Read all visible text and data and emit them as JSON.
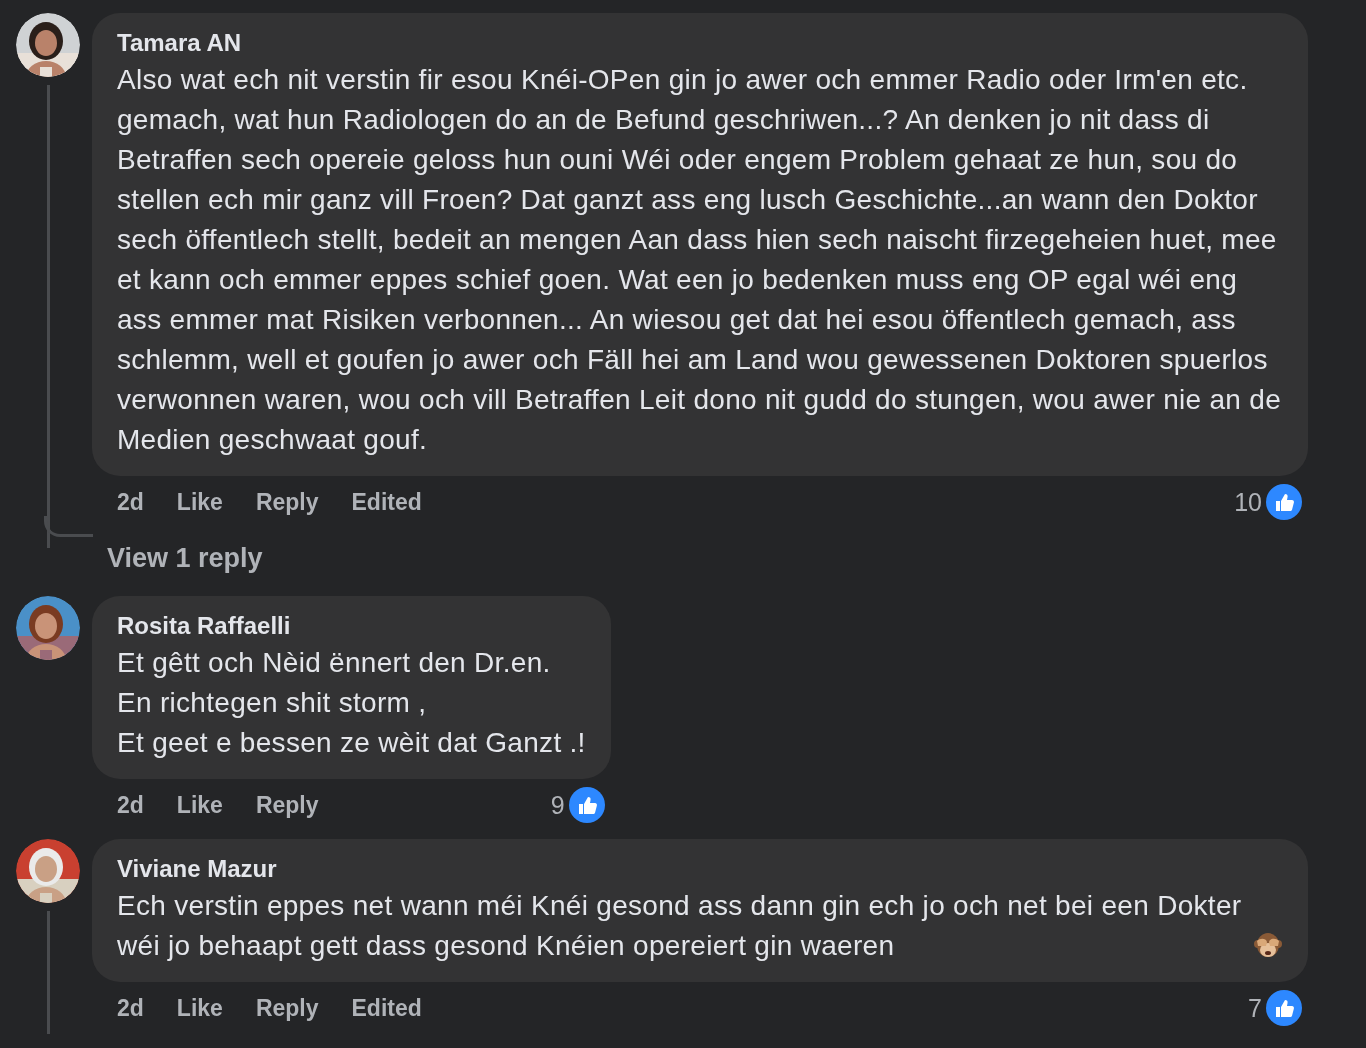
{
  "comments": [
    {
      "author": "Tamara AN",
      "text": "Also wat ech nit verstin fir esou Knéi-OPen gin jo awer och emmer Radio oder Irm'en etc. gemach, wat hun Radiologen do an de Befund geschriwen...? An denken jo nit dass di Betraffen sech opereie geloss hun ouni Wéi oder engem Problem gehaat ze hun, sou do stellen ech mir ganz vill Froen? Dat ganzt ass eng lusch Geschichte...an wann den Doktor sech öffentlech stellt, bedeit an mengen Aan dass hien sech naischt firzegeheien huet, mee et kann och emmer eppes schief goen. Wat een jo bedenken muss eng OP egal wéi eng ass emmer mat Risiken verbonnen... An wiesou get dat hei esou öffentlech gemach, ass schlemm, well et goufen jo awer och Fäll hei am Land wou gewessenen Doktoren spuerlos verwonnen waren, wou och vill Betraffen Leit dono nit gudd do stungen, wou awer nie an de Medien geschwaat gouf.",
      "emoji": false,
      "time": "2d",
      "actions": [
        "Like",
        "Reply"
      ],
      "edited": "Edited",
      "reactions": "10",
      "has_replies": true,
      "view_replies": "View 1 reply"
    },
    {
      "author": "Rosita Raffaelli",
      "text": "Et gêtt och Nèid ënnert den Dr.en.\nEn richtegen shit storm ,\nEt geet e bessen ze wèit dat Ganzt .!",
      "emoji": false,
      "time": "2d",
      "actions": [
        "Like",
        "Reply"
      ],
      "reactions": "9",
      "has_replies": false
    },
    {
      "author": "Viviane Mazur",
      "text": "Ech verstin eppes net wann méi Knéi gesond ass dann gin ech jo och net bei een Dokter wéi jo behaapt gett dass gesond Knéien opereiert gin waeren",
      "emoji": true,
      "time": "2d",
      "actions": [
        "Like",
        "Reply"
      ],
      "edited": "Edited",
      "reactions": "7",
      "has_replies": true
    }
  ]
}
